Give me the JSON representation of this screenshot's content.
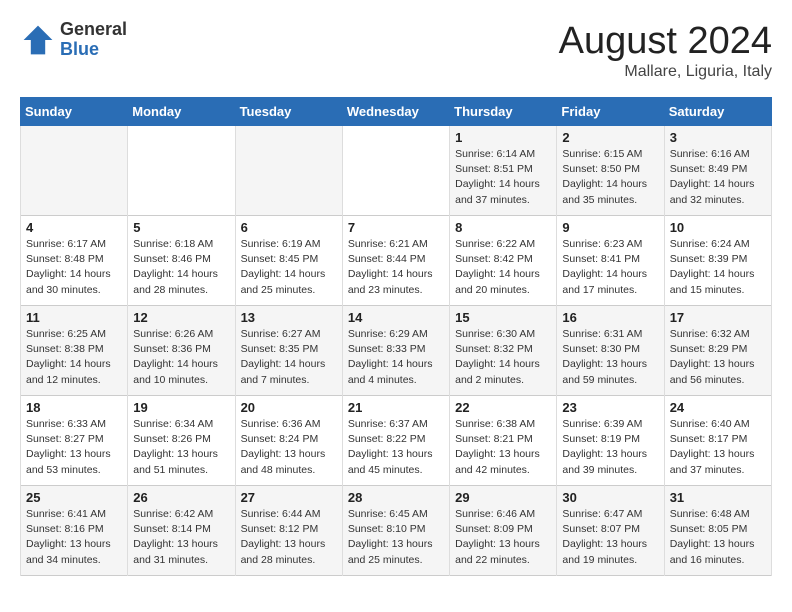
{
  "logo": {
    "general": "General",
    "blue": "Blue"
  },
  "title": {
    "month_year": "August 2024",
    "location": "Mallare, Liguria, Italy"
  },
  "days_of_week": [
    "Sunday",
    "Monday",
    "Tuesday",
    "Wednesday",
    "Thursday",
    "Friday",
    "Saturday"
  ],
  "weeks": [
    [
      {
        "day": "",
        "content": ""
      },
      {
        "day": "",
        "content": ""
      },
      {
        "day": "",
        "content": ""
      },
      {
        "day": "",
        "content": ""
      },
      {
        "day": "1",
        "content": "Sunrise: 6:14 AM\nSunset: 8:51 PM\nDaylight: 14 hours and 37 minutes."
      },
      {
        "day": "2",
        "content": "Sunrise: 6:15 AM\nSunset: 8:50 PM\nDaylight: 14 hours and 35 minutes."
      },
      {
        "day": "3",
        "content": "Sunrise: 6:16 AM\nSunset: 8:49 PM\nDaylight: 14 hours and 32 minutes."
      }
    ],
    [
      {
        "day": "4",
        "content": "Sunrise: 6:17 AM\nSunset: 8:48 PM\nDaylight: 14 hours and 30 minutes."
      },
      {
        "day": "5",
        "content": "Sunrise: 6:18 AM\nSunset: 8:46 PM\nDaylight: 14 hours and 28 minutes."
      },
      {
        "day": "6",
        "content": "Sunrise: 6:19 AM\nSunset: 8:45 PM\nDaylight: 14 hours and 25 minutes."
      },
      {
        "day": "7",
        "content": "Sunrise: 6:21 AM\nSunset: 8:44 PM\nDaylight: 14 hours and 23 minutes."
      },
      {
        "day": "8",
        "content": "Sunrise: 6:22 AM\nSunset: 8:42 PM\nDaylight: 14 hours and 20 minutes."
      },
      {
        "day": "9",
        "content": "Sunrise: 6:23 AM\nSunset: 8:41 PM\nDaylight: 14 hours and 17 minutes."
      },
      {
        "day": "10",
        "content": "Sunrise: 6:24 AM\nSunset: 8:39 PM\nDaylight: 14 hours and 15 minutes."
      }
    ],
    [
      {
        "day": "11",
        "content": "Sunrise: 6:25 AM\nSunset: 8:38 PM\nDaylight: 14 hours and 12 minutes."
      },
      {
        "day": "12",
        "content": "Sunrise: 6:26 AM\nSunset: 8:36 PM\nDaylight: 14 hours and 10 minutes."
      },
      {
        "day": "13",
        "content": "Sunrise: 6:27 AM\nSunset: 8:35 PM\nDaylight: 14 hours and 7 minutes."
      },
      {
        "day": "14",
        "content": "Sunrise: 6:29 AM\nSunset: 8:33 PM\nDaylight: 14 hours and 4 minutes."
      },
      {
        "day": "15",
        "content": "Sunrise: 6:30 AM\nSunset: 8:32 PM\nDaylight: 14 hours and 2 minutes."
      },
      {
        "day": "16",
        "content": "Sunrise: 6:31 AM\nSunset: 8:30 PM\nDaylight: 13 hours and 59 minutes."
      },
      {
        "day": "17",
        "content": "Sunrise: 6:32 AM\nSunset: 8:29 PM\nDaylight: 13 hours and 56 minutes."
      }
    ],
    [
      {
        "day": "18",
        "content": "Sunrise: 6:33 AM\nSunset: 8:27 PM\nDaylight: 13 hours and 53 minutes."
      },
      {
        "day": "19",
        "content": "Sunrise: 6:34 AM\nSunset: 8:26 PM\nDaylight: 13 hours and 51 minutes."
      },
      {
        "day": "20",
        "content": "Sunrise: 6:36 AM\nSunset: 8:24 PM\nDaylight: 13 hours and 48 minutes."
      },
      {
        "day": "21",
        "content": "Sunrise: 6:37 AM\nSunset: 8:22 PM\nDaylight: 13 hours and 45 minutes."
      },
      {
        "day": "22",
        "content": "Sunrise: 6:38 AM\nSunset: 8:21 PM\nDaylight: 13 hours and 42 minutes."
      },
      {
        "day": "23",
        "content": "Sunrise: 6:39 AM\nSunset: 8:19 PM\nDaylight: 13 hours and 39 minutes."
      },
      {
        "day": "24",
        "content": "Sunrise: 6:40 AM\nSunset: 8:17 PM\nDaylight: 13 hours and 37 minutes."
      }
    ],
    [
      {
        "day": "25",
        "content": "Sunrise: 6:41 AM\nSunset: 8:16 PM\nDaylight: 13 hours and 34 minutes."
      },
      {
        "day": "26",
        "content": "Sunrise: 6:42 AM\nSunset: 8:14 PM\nDaylight: 13 hours and 31 minutes."
      },
      {
        "day": "27",
        "content": "Sunrise: 6:44 AM\nSunset: 8:12 PM\nDaylight: 13 hours and 28 minutes."
      },
      {
        "day": "28",
        "content": "Sunrise: 6:45 AM\nSunset: 8:10 PM\nDaylight: 13 hours and 25 minutes."
      },
      {
        "day": "29",
        "content": "Sunrise: 6:46 AM\nSunset: 8:09 PM\nDaylight: 13 hours and 22 minutes."
      },
      {
        "day": "30",
        "content": "Sunrise: 6:47 AM\nSunset: 8:07 PM\nDaylight: 13 hours and 19 minutes."
      },
      {
        "day": "31",
        "content": "Sunrise: 6:48 AM\nSunset: 8:05 PM\nDaylight: 13 hours and 16 minutes."
      }
    ]
  ]
}
